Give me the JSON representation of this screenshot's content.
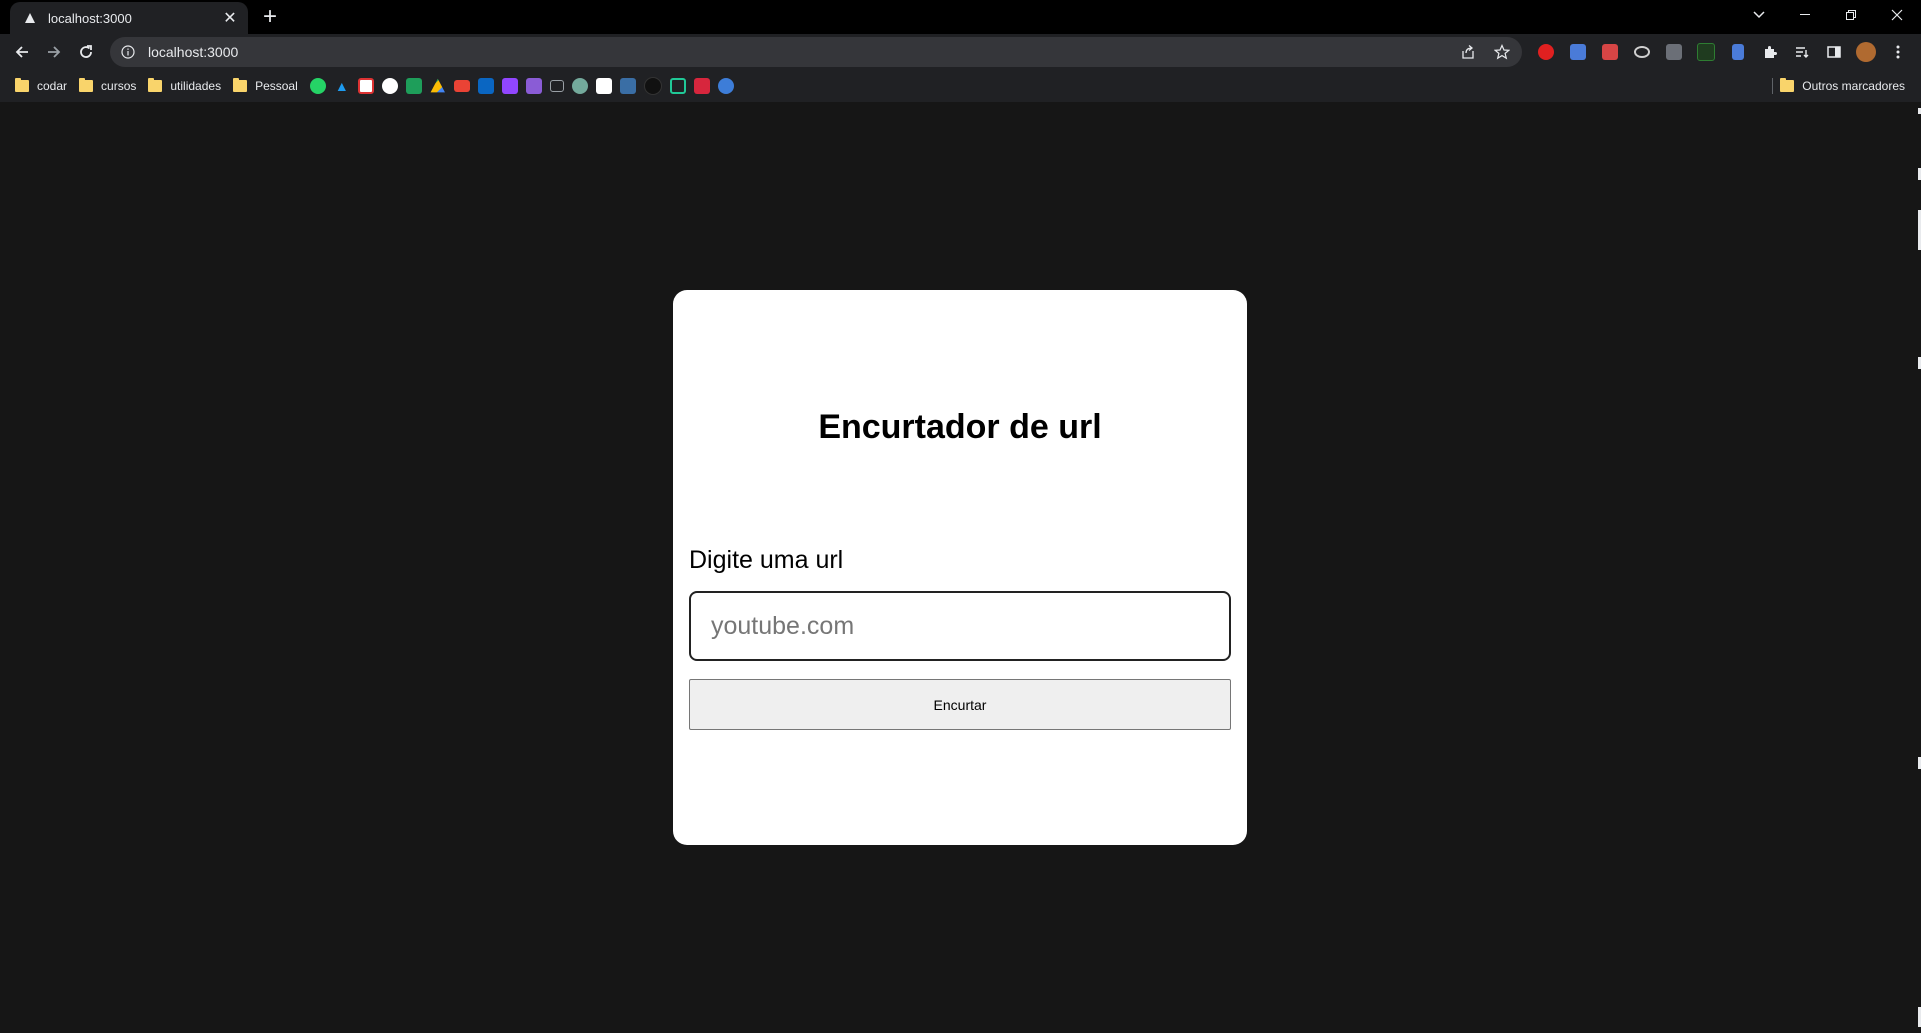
{
  "browser": {
    "tab": {
      "title": "localhost:3000"
    },
    "address": {
      "url": "localhost:3000"
    },
    "bookmarks": {
      "folders": [
        "codar",
        "cursos",
        "utilidades",
        "Pessoal"
      ],
      "other_folder": "Outros marcadores",
      "icons": [
        "whatsapp-icon",
        "twitter-icon",
        "bookmark-app-icon",
        "github-icon",
        "bookmark-app-icon",
        "google-drive-icon",
        "gmail-icon",
        "linkedin-icon",
        "twitch-icon",
        "bookmark-app-icon",
        "bookmark-app-icon",
        "chatgpt-icon",
        "bookmark-app-icon",
        "bookmark-app-icon",
        "bookmark-app-icon",
        "bookmark-app-icon",
        "bookmark-app-icon",
        "bookmark-app-icon"
      ]
    }
  },
  "page": {
    "title": "Encurtador de url",
    "input_label": "Digite uma url",
    "input_placeholder": "youtube.com",
    "button_label": "Encurtar"
  },
  "colors": {
    "page_background": "#161616",
    "card_background": "#ffffff",
    "button_background": "#efefef"
  }
}
